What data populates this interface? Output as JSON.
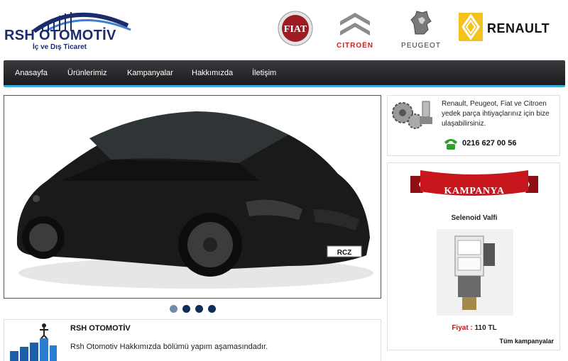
{
  "header": {
    "logo_title": "RSH OTOMOTİV",
    "logo_subtitle": "İç ve Dış Ticaret",
    "brands": [
      {
        "name": "Fiat",
        "label": "FIAT"
      },
      {
        "name": "Citroen",
        "label": "CITROËN"
      },
      {
        "name": "Peugeot",
        "label": "PEUGEOT"
      },
      {
        "name": "Renault",
        "label": "RENAULT"
      }
    ]
  },
  "nav": {
    "items": [
      "Anasayfa",
      "Ürünlerimiz",
      "Kampanyalar",
      "Hakkımızda",
      "İletişim"
    ]
  },
  "slider": {
    "plate_text": "RCZ",
    "slides_count": 4,
    "active_slide": 1
  },
  "about": {
    "title": "RSH OTOMOTİV",
    "text": "Rsh Otomotiv Hakkımızda bölümü yapım aşamasındadır."
  },
  "contact": {
    "text": "Renault, Peugeot, Fiat ve Citroen yedek parça ihtiyaçlarınız için bize ulaşabilirsiniz.",
    "phone": "0216 627 00 56"
  },
  "campaign": {
    "ribbon": "KAMPANYA",
    "product_name": "Selenoid Valfi",
    "price_label": "Fiyat :",
    "price_value": "110 TL",
    "all_link": "Tüm kampanyalar"
  },
  "colors": {
    "nav_accent": "#39a9d6",
    "logo_blue": "#1c2b6b",
    "citroen_red": "#d7191c",
    "ribbon_red": "#c8161d",
    "renault_yellow": "#f4c21c"
  }
}
